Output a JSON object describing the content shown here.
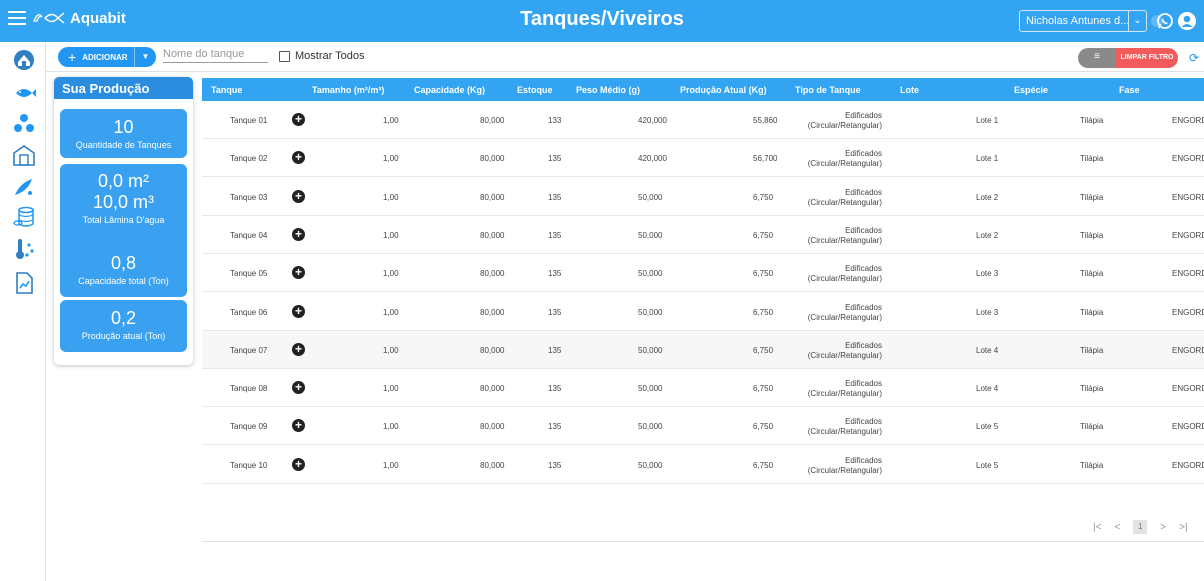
{
  "app": {
    "name": "Aquabit",
    "title": "Tanques/Viveiros"
  },
  "user": {
    "name": "Nicholas Antunes d..."
  },
  "toolbar": {
    "add_label": "ADICIONAR",
    "search_placeholder": "Nome do tanque",
    "show_all_label": "Mostrar Todos",
    "clear_filter_label": "LIMPAR FILTRO"
  },
  "production": {
    "title": "Sua Produção",
    "tank_count": "10",
    "tank_count_label": "Quantidade de Tanques",
    "area_m2": "0,0 m²",
    "volume_m3": "10,0 m³",
    "water_label": "Total Lâmina D'agua",
    "capacity": "0,8",
    "capacity_label": "Capacidade total (Ton)",
    "current": "0,2",
    "current_label": "Produção atual (Ton)"
  },
  "table": {
    "columns": [
      "Tanque",
      "Tamanho (m²/m³)",
      "Capacidade (Kg)",
      "Estoque",
      "Peso Médio (g)",
      "Produção Atual (Kg)",
      "Tipo de Tanque",
      "Lote",
      "Espécie",
      "Fase"
    ],
    "rows": [
      {
        "tanque": "Tanque 01",
        "tamanho": "1,00",
        "capacidade": "80,000",
        "estoque": "133",
        "peso": "420,000",
        "producao": "55,860",
        "tipo1": "Edificados",
        "tipo2": "(Circular/Retangular)",
        "lote": "Lote 1",
        "especie": "Tilápia",
        "fase": "ENGORDA"
      },
      {
        "tanque": "Tanque 02",
        "tamanho": "1,00",
        "capacidade": "80,000",
        "estoque": "135",
        "peso": "420,000",
        "producao": "56,700",
        "tipo1": "Edificados",
        "tipo2": "(Circular/Retangular)",
        "lote": "Lote 1",
        "especie": "Tilápia",
        "fase": "ENGORDA"
      },
      {
        "tanque": "Tanque 03",
        "tamanho": "1,00",
        "capacidade": "80,000",
        "estoque": "135",
        "peso": "50,000",
        "producao": "6,750",
        "tipo1": "Edificados",
        "tipo2": "(Circular/Retangular)",
        "lote": "Lote 2",
        "especie": "Tilápia",
        "fase": "ENGORDA"
      },
      {
        "tanque": "Tanque 04",
        "tamanho": "1,00",
        "capacidade": "80,000",
        "estoque": "135",
        "peso": "50,000",
        "producao": "6,750",
        "tipo1": "Edificados",
        "tipo2": "(Circular/Retangular)",
        "lote": "Lote 2",
        "especie": "Tilápia",
        "fase": "ENGORDA"
      },
      {
        "tanque": "Tanque 05",
        "tamanho": "1,00",
        "capacidade": "80,000",
        "estoque": "135",
        "peso": "50,000",
        "producao": "6,750",
        "tipo1": "Edificados",
        "tipo2": "(Circular/Retangular)",
        "lote": "Lote 3",
        "especie": "Tilápia",
        "fase": "ENGORDA"
      },
      {
        "tanque": "Tanque 06",
        "tamanho": "1,00",
        "capacidade": "80,000",
        "estoque": "135",
        "peso": "50,000",
        "producao": "6,750",
        "tipo1": "Edificados",
        "tipo2": "(Circular/Retangular)",
        "lote": "Lote 3",
        "especie": "Tilápia",
        "fase": "ENGORDA"
      },
      {
        "tanque": "Tanque 07",
        "tamanho": "1,00",
        "capacidade": "80,000",
        "estoque": "135",
        "peso": "50,000",
        "producao": "6,750",
        "tipo1": "Edificados",
        "tipo2": "(Circular/Retangular)",
        "lote": "Lote 4",
        "especie": "Tilápia",
        "fase": "ENGORDA"
      },
      {
        "tanque": "Tanque 08",
        "tamanho": "1,00",
        "capacidade": "80,000",
        "estoque": "135",
        "peso": "50,000",
        "producao": "6,750",
        "tipo1": "Edificados",
        "tipo2": "(Circular/Retangular)",
        "lote": "Lote 4",
        "especie": "Tilápia",
        "fase": "ENGORDA"
      },
      {
        "tanque": "Tanque 09",
        "tamanho": "1,00",
        "capacidade": "80,000",
        "estoque": "135",
        "peso": "50,000",
        "producao": "6,750",
        "tipo1": "Edificados",
        "tipo2": "(Circular/Retangular)",
        "lote": "Lote 5",
        "especie": "Tilápia",
        "fase": "ENGORDA"
      },
      {
        "tanque": "Tanque 10",
        "tamanho": "1,00",
        "capacidade": "80,000",
        "estoque": "135",
        "peso": "50,000",
        "producao": "6,750",
        "tipo1": "Edificados",
        "tipo2": "(Circular/Retangular)",
        "lote": "Lote 5",
        "especie": "Tilápia",
        "fase": "ENGORDA"
      }
    ]
  },
  "pager": {
    "current_page": "1"
  },
  "icons": {
    "sidebar": [
      "home-icon",
      "fish-icon",
      "ponds-icon",
      "building-icon",
      "feed-icon",
      "database-icon",
      "thermometer-icon",
      "report-icon"
    ]
  },
  "colors": {
    "primary": "#33a4f2",
    "stat_card": "#3aa0f0",
    "danger": "#f15b5b"
  }
}
